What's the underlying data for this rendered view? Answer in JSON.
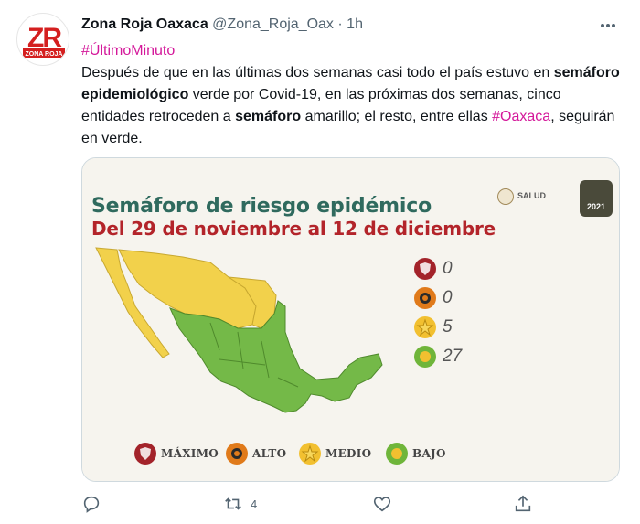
{
  "tweet": {
    "author_name": "Zona Roja Oaxaca",
    "author_handle": "@Zona_Roja_Oax",
    "separator": "·",
    "time": "1h",
    "avatar_text_top": "ZR",
    "avatar_text_bottom": "ZONA ROJA",
    "hashtag_line": "#ÚltimoMinuto",
    "body": {
      "part1": "Después de que en las últimas dos semanas casi todo el país estuvo en ",
      "bold1": "semáforo epidemiológico",
      "part2": " verde por Covid-19, en las próximas dos semanas, cinco entidades retroceden a ",
      "bold2": "semáforo",
      "part3": " amarillo; el resto, entre ellas ",
      "hashtag": "#Oaxaca",
      "part4": ", seguirán en verde."
    },
    "more_icon": "ellipsis-icon"
  },
  "media": {
    "title": "Semáforo de riesgo epidémico",
    "subtitle": "Del 29 de noviembre al 12 de diciembre",
    "salud_label": "SALUD",
    "year_badge": "2021",
    "counts": [
      {
        "level": "maximo",
        "value": "0",
        "color": "#a3232a",
        "icon": "shield-icon"
      },
      {
        "level": "alto",
        "value": "0",
        "color": "#e07a1a",
        "icon": "gear-icon"
      },
      {
        "level": "medio",
        "value": "5",
        "color": "#f2c030",
        "icon": "star-icon"
      },
      {
        "level": "bajo",
        "value": "27",
        "color": "#6fb53a",
        "icon": "sun-icon"
      }
    ],
    "legend": [
      {
        "label": "MÁXIMO",
        "color": "#a3232a"
      },
      {
        "label": "ALTO",
        "color": "#e07a1a"
      },
      {
        "label": "MEDIO",
        "color": "#f2c030"
      },
      {
        "label": "BAJO",
        "color": "#6fb53a"
      }
    ],
    "map_colors": {
      "yellow": "#f2d14b",
      "green": "#74b948"
    }
  },
  "actions": {
    "reply_icon": "reply-icon",
    "retweet_icon": "retweet-icon",
    "retweet_count": "4",
    "like_icon": "heart-icon",
    "share_icon": "share-icon"
  }
}
